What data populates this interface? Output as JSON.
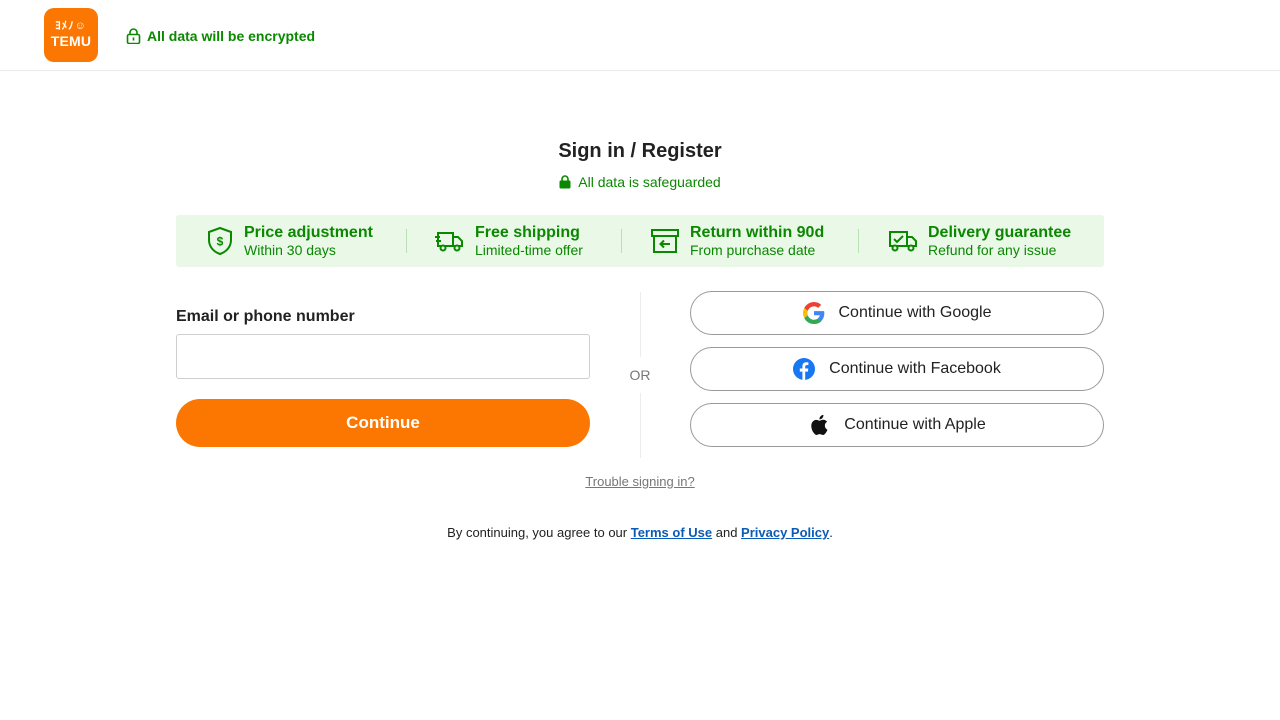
{
  "header": {
    "logo_glyphs": "ﾖﾒﾉ☺",
    "logo_text": "TEMU",
    "encrypted_text": "All data will be encrypted"
  },
  "main": {
    "title": "Sign in / Register",
    "safeguard_text": "All data is safeguarded",
    "benefits": [
      {
        "title": "Price adjustment",
        "subtitle": "Within 30 days",
        "icon": "shield-dollar-icon"
      },
      {
        "title": "Free shipping",
        "subtitle": "Limited-time offer",
        "icon": "truck-icon"
      },
      {
        "title": "Return within 90d",
        "subtitle": "From purchase date",
        "icon": "return-box-icon"
      },
      {
        "title": "Delivery guarantee",
        "subtitle": "Refund for any issue",
        "icon": "truck-check-icon"
      }
    ],
    "email_label": "Email or phone number",
    "email_value": "",
    "email_placeholder": "",
    "continue_label": "Continue",
    "or_text": "OR",
    "social": {
      "google": "Continue with Google",
      "facebook": "Continue with Facebook",
      "apple": "Continue with Apple"
    },
    "trouble_text": "Trouble signing in?",
    "terms": {
      "prefix": "By continuing, you agree to our ",
      "terms_link": "Terms of Use",
      "middle": " and ",
      "privacy_link": "Privacy Policy",
      "suffix": "."
    }
  },
  "colors": {
    "brand_orange": "#fb7701",
    "green": "#0a8800",
    "benefit_bg": "#eaf8e8",
    "link_blue": "#0a5bb5"
  }
}
